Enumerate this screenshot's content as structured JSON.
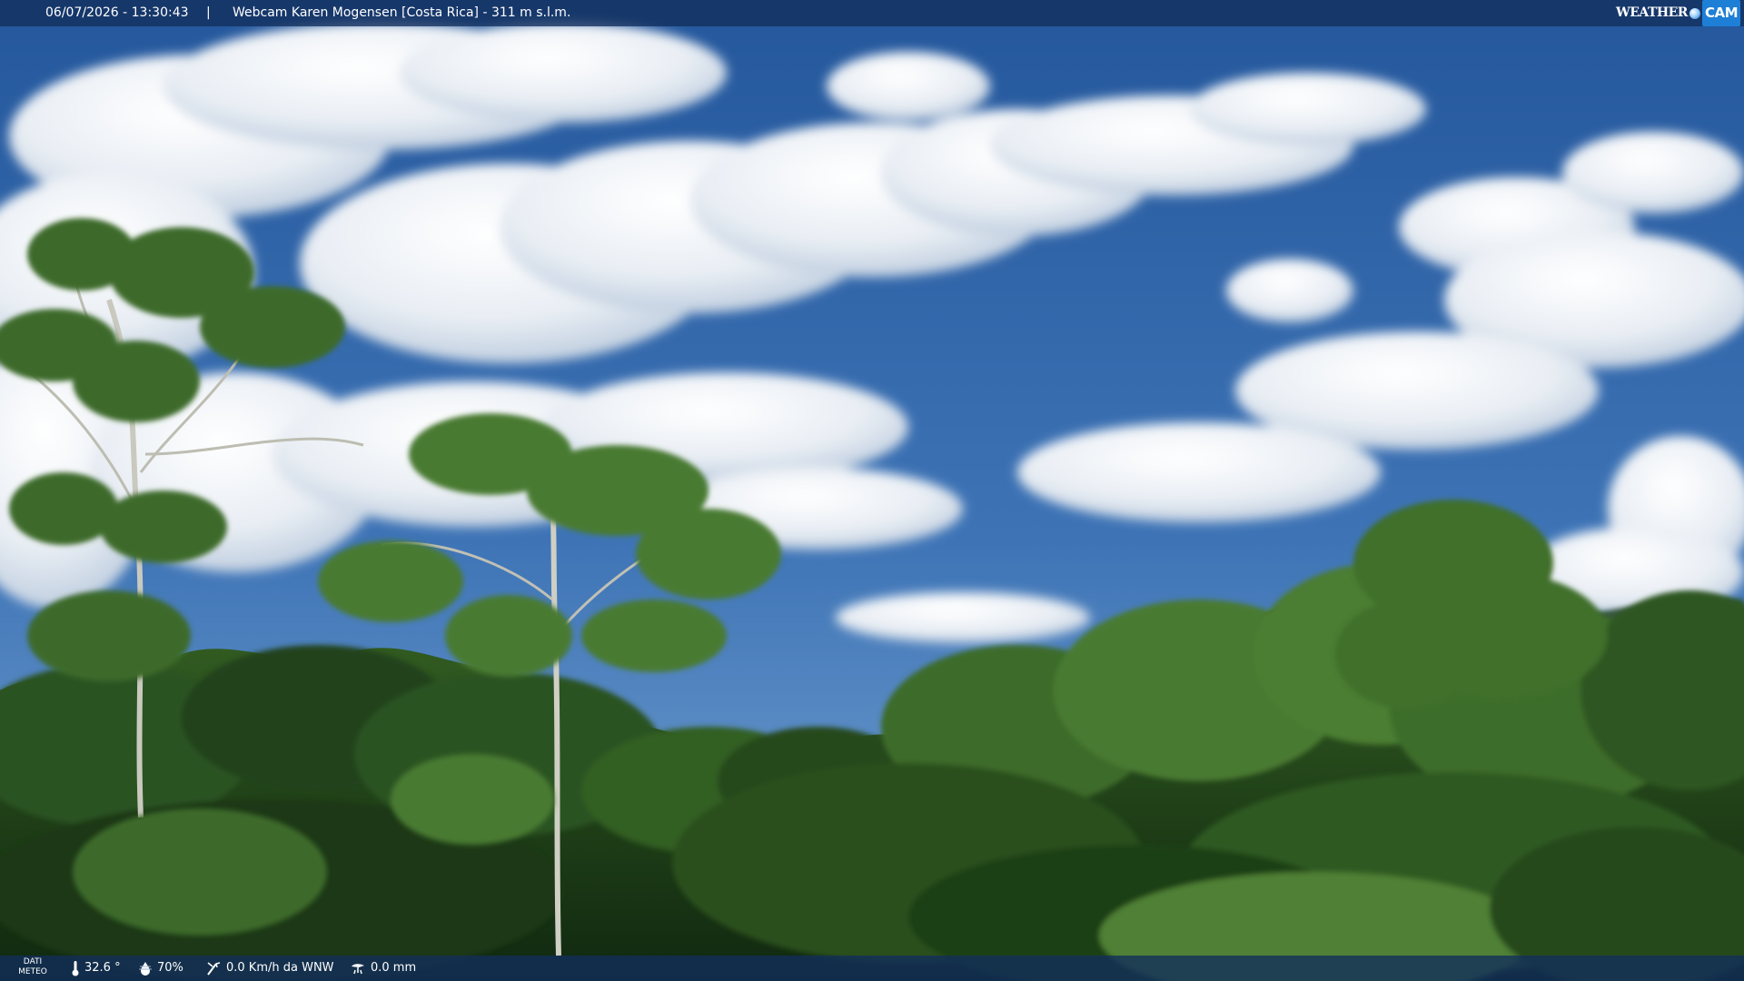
{
  "header": {
    "datetime": "06/07/2026 - 13:30:43",
    "separator": "|",
    "title": "Webcam Karen Mogensen [Costa Rica] - 311 m s.l.m.",
    "logo": {
      "word": "WEATHER",
      "suffix": "CAM",
      "icon": "globe-icon"
    }
  },
  "footer": {
    "label_line1": "DATI",
    "label_line2": "METEO",
    "temperature": "32.6 °",
    "temperature_icon": "thermometer-icon",
    "humidity": "70%",
    "humidity_icon": "humidity-drop-icon",
    "wind": "0.0 Km/h da WNW",
    "wind_icon": "wind-vane-icon",
    "rain": "0.0 mm",
    "rain_icon": "rain-gauge-icon"
  },
  "colors": {
    "sky_top": "#2b5fa3",
    "sky_bottom": "#6d9ccf",
    "cloud": "#f2f5f8",
    "foliage_dark": "#14300f",
    "foliage_mid": "#2f5a1c",
    "foliage_light": "#5d8f38",
    "overlay_bar": "#122e5c"
  }
}
